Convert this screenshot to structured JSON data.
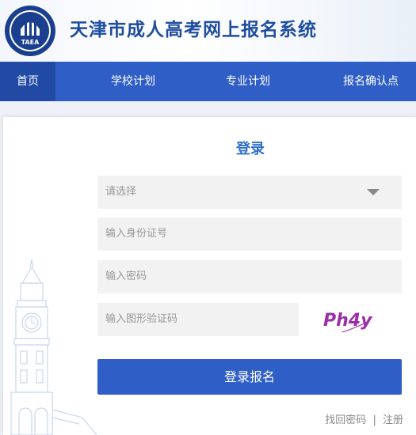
{
  "header": {
    "title": "天津市成人高考网上报名系统",
    "logo_text": "TAEA"
  },
  "nav": {
    "items": [
      {
        "label": "首页"
      },
      {
        "label": "学校计划"
      },
      {
        "label": "专业计划"
      },
      {
        "label": "报名确认点"
      }
    ],
    "active_index": 0
  },
  "login": {
    "title": "登录",
    "select_placeholder": "请选择",
    "id_placeholder": "输入身份证号",
    "password_placeholder": "输入密码",
    "captcha_placeholder": "输入图形验证码",
    "captcha_text": "Ph4y",
    "submit_label": "登录报名",
    "forgot_label": "找回密码",
    "separator": "|",
    "register_label": "注册"
  },
  "colors": {
    "primary": "#2f5ec7",
    "title": "#1f4ea0",
    "captcha": "#9a2ea8"
  }
}
